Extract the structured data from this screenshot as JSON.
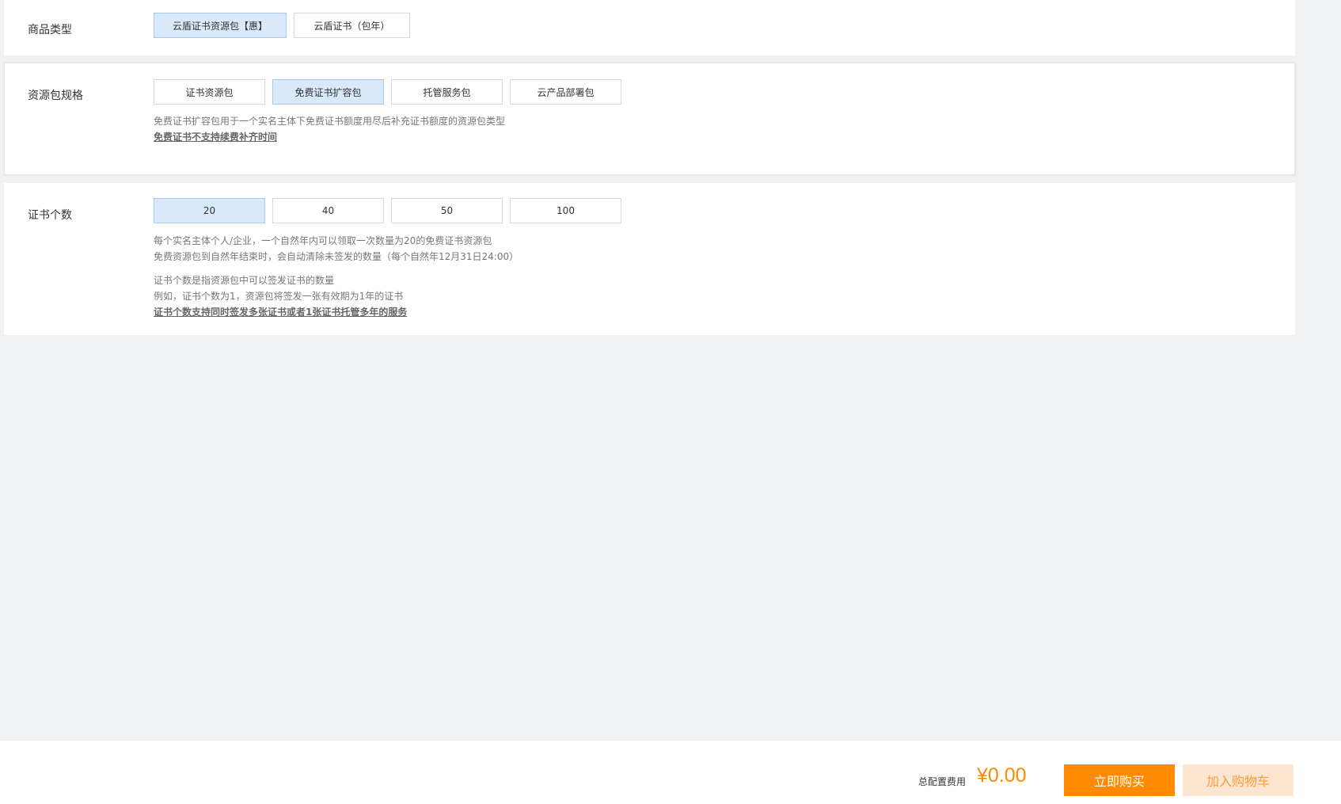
{
  "product_type": {
    "label": "商品类型",
    "options": [
      {
        "label": "云盾证书资源包【惠】",
        "selected": true
      },
      {
        "label": "云盾证书（包年）",
        "selected": false
      }
    ]
  },
  "package_spec": {
    "label": "资源包规格",
    "options": [
      {
        "label": "证书资源包",
        "selected": false
      },
      {
        "label": "免费证书扩容包",
        "selected": true
      },
      {
        "label": "托管服务包",
        "selected": false
      },
      {
        "label": "云产品部署包",
        "selected": false
      }
    ],
    "hints": [
      "免费证书扩容包用于一个实名主体下免费证书额度用尽后补充证书额度的资源包类型",
      "免费证书不支持续费补齐时间"
    ]
  },
  "cert_count": {
    "label": "证书个数",
    "options": [
      {
        "label": "20",
        "selected": true
      },
      {
        "label": "40",
        "selected": false
      },
      {
        "label": "50",
        "selected": false
      },
      {
        "label": "100",
        "selected": false
      }
    ],
    "hints": [
      "每个实名主体个人/企业，一个自然年内可以领取一次数量为20的免费证书资源包",
      "免费资源包到自然年结束时，会自动清除未签发的数量（每个自然年12月31日24:00）",
      "证书个数是指资源包中可以签发证书的数量",
      "例如，证书个数为1，资源包将签发一张有效期为1年的证书",
      "证书个数支持同时签发多张证书或者1张证书托管多年的服务"
    ]
  },
  "footer": {
    "fee_label": "总配置费用",
    "price": "¥0.00",
    "buy_label": "立即购买",
    "cart_label": "加入购物车"
  },
  "colors": {
    "accent": "#ff8a00",
    "selected_bg": "#d8e9f9",
    "page_bg": "#eff1f3"
  }
}
